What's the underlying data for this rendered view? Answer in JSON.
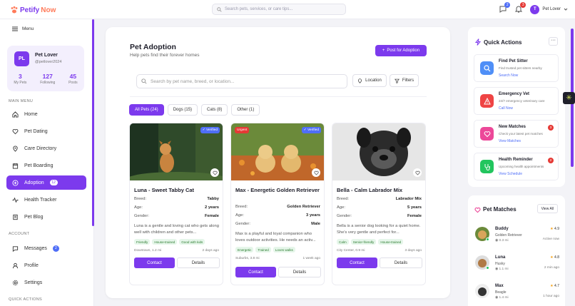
{
  "brand": {
    "name_part1": "Petify",
    "name_part2": "Now",
    "accent": "#7c3aed"
  },
  "topbar": {
    "search_placeholder": "Search pets, services, or care tips...",
    "messages_count": "2",
    "notifications_count": "3",
    "user_initial": "T",
    "user_name": "Pet Lover"
  },
  "sidebar": {
    "menu_label": "Menu",
    "profile": {
      "initials": "PL",
      "name": "Pet Lover",
      "handle": "@petlover2024",
      "stats": [
        {
          "value": "3",
          "label": "My Pets"
        },
        {
          "value": "127",
          "label": "Following"
        },
        {
          "value": "45",
          "label": "Posts"
        }
      ]
    },
    "main_menu_heading": "MAIN MENU",
    "main_items": [
      {
        "label": "Home",
        "icon": "home-icon"
      },
      {
        "label": "Pet Dating",
        "icon": "heart-icon"
      },
      {
        "label": "Care Directory",
        "icon": "location-icon"
      },
      {
        "label": "Pet Boarding",
        "icon": "calendar-icon"
      },
      {
        "label": "Adoption",
        "icon": "plus-circle-icon",
        "badge": "12",
        "active": true
      },
      {
        "label": "Health Tracker",
        "icon": "activity-icon"
      },
      {
        "label": "Pet Blog",
        "icon": "book-icon"
      }
    ],
    "account_heading": "ACCOUNT",
    "account_items": [
      {
        "label": "Messages",
        "icon": "message-icon",
        "badge": "2"
      },
      {
        "label": "Profile",
        "icon": "user-icon"
      },
      {
        "label": "Settings",
        "icon": "gear-icon"
      }
    ],
    "quick_actions_heading": "QUICK ACTIONS"
  },
  "page": {
    "title": "Pet Adoption",
    "subtitle": "Help pets find their forever homes",
    "post_button": "Post for Adoption",
    "search_placeholder": "Search by pet name, breed, or location...",
    "location_button": "Location",
    "filters_button": "Filters",
    "tabs": [
      {
        "label": "All Pets (24)",
        "active": true
      },
      {
        "label": "Dogs (15)"
      },
      {
        "label": "Cats (8)"
      },
      {
        "label": "Other (1)"
      }
    ]
  },
  "pets": [
    {
      "name": "Luna - Sweet Tabby Cat",
      "badge_verified": "✓ Verified",
      "badge_urgent": "",
      "breed_label": "Breed:",
      "breed": "Tabby",
      "age_label": "Age:",
      "age": "2 years",
      "gender_label": "Gender:",
      "gender": "Female",
      "description": "Luna is a gentle and loving cat who gets along well with children and other pets...",
      "tags": [
        "Friendly",
        "House-trained",
        "Good with kids"
      ],
      "location": "Downtown, 1.2 mi",
      "posted": "2 days ago",
      "contact": "Contact",
      "details": "Details"
    },
    {
      "name": "Max - Energetic Golden Retriever",
      "badge_verified": "✓ Verified",
      "badge_urgent": "Urgent",
      "breed_label": "Breed:",
      "breed": "Golden Retriever",
      "age_label": "Age:",
      "age": "3 years",
      "gender_label": "Gender:",
      "gender": "Male",
      "description": "Max is a playful and loyal companion who loves outdoor activities. He needs an activ...",
      "tags": [
        "Energetic",
        "Trained",
        "Loves walks"
      ],
      "location": "Suburbs, 3.8 mi",
      "posted": "1 week ago",
      "contact": "Contact",
      "details": "Details"
    },
    {
      "name": "Bella - Calm Labrador Mix",
      "badge_verified": "",
      "badge_urgent": "",
      "breed_label": "Breed:",
      "breed": "Labrador Mix",
      "age_label": "Age:",
      "age": "5 years",
      "gender_label": "Gender:",
      "gender": "Female",
      "description": "Bella is a senior dog looking for a quiet home. She's very gentle and perfect for...",
      "tags": [
        "Calm",
        "Senior-friendly",
        "House-trained"
      ],
      "location": "City Center, 0.9 mi",
      "posted": "3 days ago",
      "contact": "Contact",
      "details": "Details"
    }
  ],
  "quick_actions": {
    "title": "Quick Actions",
    "more": "···",
    "items": [
      {
        "title": "Find Pet Sitter",
        "subtitle": "Find trusted pet sitters nearby",
        "link": "Search Now",
        "color": "#4f8ff7",
        "badge": ""
      },
      {
        "title": "Emergency Vet",
        "subtitle": "24/7 emergency veterinary care",
        "link": "Call Now",
        "color": "#ef4444",
        "badge": ""
      },
      {
        "title": "New Matches",
        "subtitle": "Check your latest pet matches",
        "link": "View Matches",
        "color": "#ec4899",
        "badge": "3"
      },
      {
        "title": "Health Reminder",
        "subtitle": "Upcoming health appointments",
        "link": "View Schedule",
        "color": "#22c55e",
        "badge": "2"
      }
    ]
  },
  "pet_matches": {
    "title": "Pet Matches",
    "view_all": "View All",
    "items": [
      {
        "name": "Buddy",
        "breed": "Golden Retriever",
        "distance": "0.3 mi",
        "rating": "4.9",
        "status": "Active now"
      },
      {
        "name": "Luna",
        "breed": "Husky",
        "distance": "1.1 mi",
        "rating": "4.8",
        "status": "2 min ago"
      },
      {
        "name": "Max",
        "breed": "Beagle",
        "distance": "1.4 mi",
        "rating": "4.7",
        "status": "1 hour ago"
      }
    ]
  }
}
